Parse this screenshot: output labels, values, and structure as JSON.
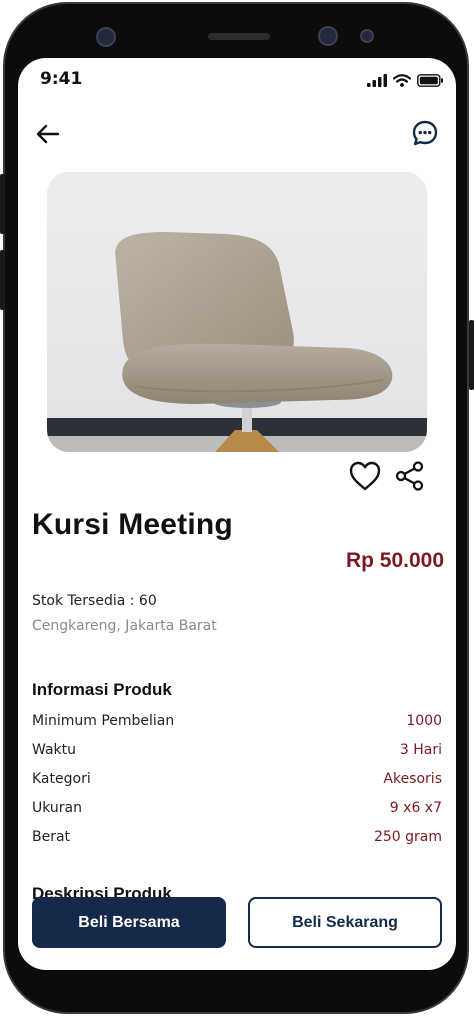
{
  "status_bar": {
    "time": "9:41",
    "icons": [
      "signal-icon",
      "wifi-icon",
      "battery-icon"
    ]
  },
  "nav": {
    "back_icon": "arrow-left-icon",
    "chat_icon": "chat-bubble-icon"
  },
  "product": {
    "title": "Kursi Meeting",
    "price": "Rp 50.000",
    "stock": "Stok Tersedia : 60",
    "location": "Cengkareng, Jakarta Barat",
    "image": "chair-photo"
  },
  "actions": {
    "favorite_icon": "heart-icon",
    "share_icon": "share-icon"
  },
  "info": {
    "heading": "Informasi Produk",
    "rows": [
      {
        "label": "Minimum Pembelian",
        "value": "1000"
      },
      {
        "label": "Waktu",
        "value": "3 Hari"
      },
      {
        "label": "Kategori",
        "value": "Akesoris"
      },
      {
        "label": "Ukuran",
        "value": "9 x6 x7"
      },
      {
        "label": "Berat",
        "value": "250 gram"
      }
    ]
  },
  "description": {
    "heading": "Deskripsi Produk"
  },
  "buttons": {
    "group_buy": "Beli Bersama",
    "buy_now": "Beli Sekarang"
  },
  "colors": {
    "primary": "#15294a",
    "accent": "#7a1a23"
  }
}
